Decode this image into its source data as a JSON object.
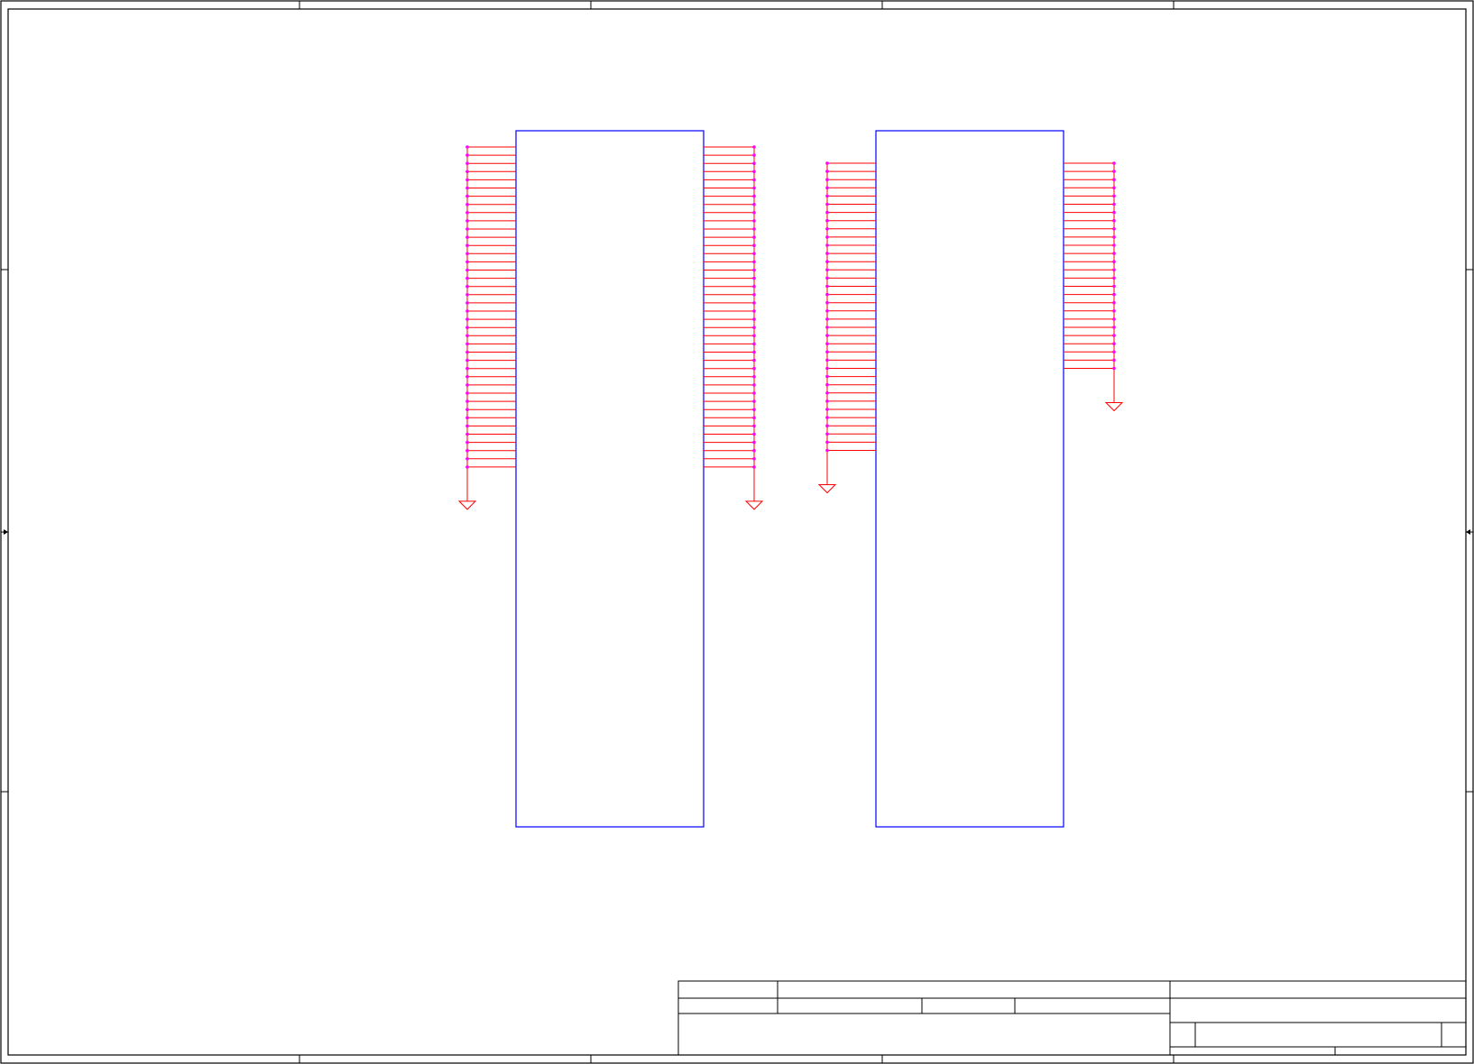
{
  "colors": {
    "border": "#000000",
    "component_outline": "#0000ff",
    "net_wire": "#ff0000",
    "junction": "#ff00ff",
    "ground": "#ff0000",
    "background": "#ffffff"
  },
  "sheet": {
    "zone_ticks_horizontal": 5,
    "zone_ticks_vertical": 4
  },
  "connectors": [
    {
      "id": "connector-1",
      "left_pins": 40,
      "right_pins": 40
    },
    {
      "id": "connector-2",
      "left_pins": 36,
      "right_pins": 26
    }
  ],
  "title_block": {
    "cells": []
  }
}
